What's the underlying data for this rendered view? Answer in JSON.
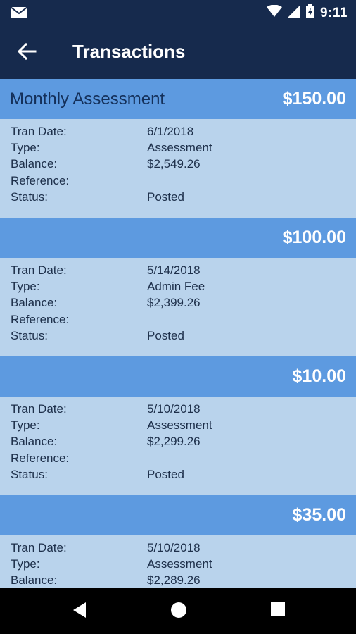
{
  "status_bar": {
    "time": "9:11",
    "icons": [
      "mail-icon",
      "wifi-icon",
      "signal-icon",
      "battery-icon"
    ]
  },
  "app_bar": {
    "title": "Transactions",
    "back_icon": "arrow-back-icon"
  },
  "labels": {
    "tran_date": "Tran Date:",
    "type": "Type:",
    "balance": "Balance:",
    "reference": "Reference:",
    "status": "Status:"
  },
  "transactions": [
    {
      "description": "Monthly Assessment",
      "amount": "$150.00",
      "tran_date": "6/1/2018",
      "type": "Assessment",
      "balance": "$2,549.26",
      "reference": "",
      "status": "Posted"
    },
    {
      "description": "",
      "amount": "$100.00",
      "tran_date": "5/14/2018",
      "type": "Admin Fee",
      "balance": "$2,399.26",
      "reference": "",
      "status": "Posted"
    },
    {
      "description": "",
      "amount": "$10.00",
      "tran_date": "5/10/2018",
      "type": "Assessment",
      "balance": "$2,299.26",
      "reference": "",
      "status": "Posted"
    },
    {
      "description": "",
      "amount": "$35.00",
      "tran_date": "5/10/2018",
      "type": "Assessment",
      "balance": "$2,289.26",
      "reference": "",
      "status": ""
    }
  ],
  "colors": {
    "app_bar": "#162a4d",
    "card_header": "#5d9ae0",
    "card_body": "#b9d3ec"
  },
  "nav_bar": {
    "icons": [
      "back-triangle-icon",
      "home-circle-icon",
      "recents-square-icon"
    ]
  }
}
